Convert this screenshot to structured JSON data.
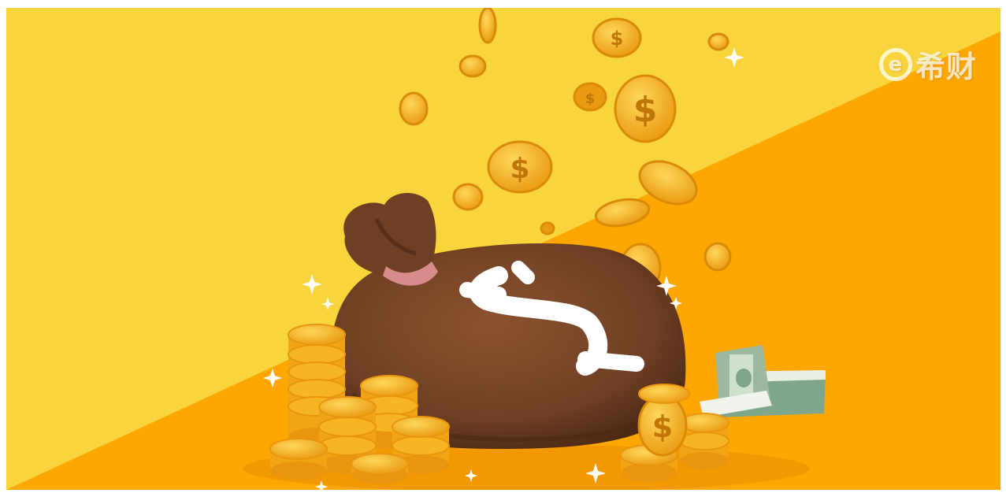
{
  "image": {
    "subject": "money-bag-with-coins-illustration",
    "colors": {
      "background_light": "#F8D53C",
      "background_orange": "#FEA700",
      "bag": "#6E3F23",
      "coin": "#F7B824"
    },
    "icons": [
      "money-bag-icon",
      "dollar-sign-icon",
      "coin-icon",
      "banknote-stack-icon",
      "sparkle-icon"
    ]
  },
  "watermark": {
    "mark": "e",
    "brand": "希财"
  }
}
